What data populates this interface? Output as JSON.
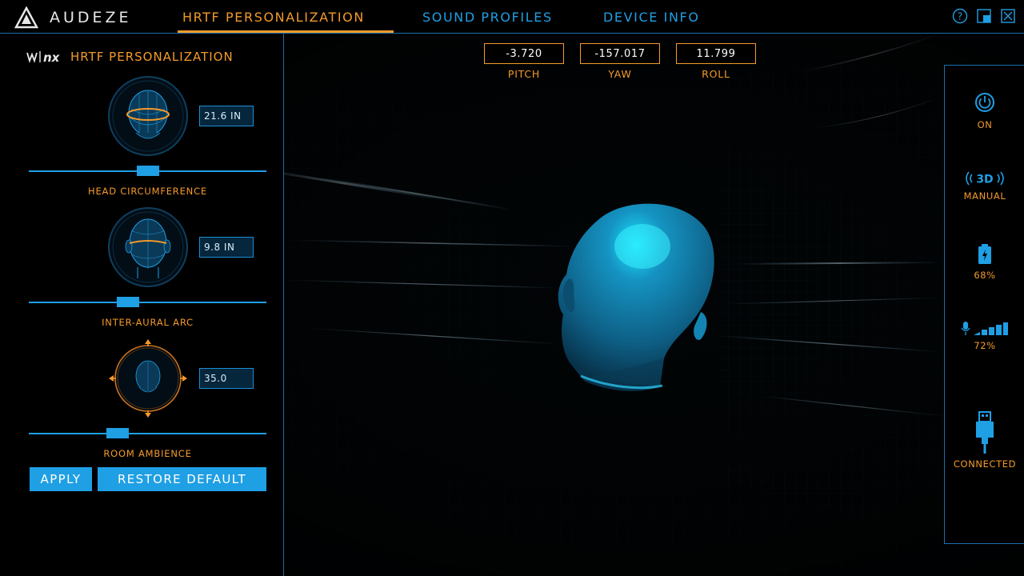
{
  "app": {
    "brand": "AUDEZE",
    "nav_tabs": [
      {
        "label": "HRTF PERSONALIZATION",
        "active": true
      },
      {
        "label": "SOUND PROFILES",
        "active": false
      },
      {
        "label": "DEVICE INFO",
        "active": false
      }
    ]
  },
  "hrtf": {
    "title": "HRTF PERSONALIZATION",
    "logo_mark": "nx",
    "params": [
      {
        "label": "HEAD CIRCUMFERENCE",
        "value": "21.6 IN",
        "slider_pct": 50
      },
      {
        "label": "INTER-AURAL ARC",
        "value": "9.8 IN",
        "slider_pct": 41
      },
      {
        "label": "ROOM AMBIENCE",
        "value": "35.0",
        "slider_pct": 36
      }
    ],
    "apply_label": "APPLY",
    "restore_label": "RESTORE DEFAULT"
  },
  "orientation": {
    "pitch": {
      "value": "-3.720",
      "label": "PITCH"
    },
    "yaw": {
      "value": "-157.017",
      "label": "YAW"
    },
    "roll": {
      "value": "11.799",
      "label": "ROLL"
    }
  },
  "status": {
    "power": {
      "label": "ON",
      "icon": "power-icon"
    },
    "mode": {
      "badge": "3D",
      "label": "MANUAL",
      "icon": "3d-audio-icon"
    },
    "battery": {
      "label": "68%",
      "level": 0.68,
      "icon": "battery-icon"
    },
    "signal": {
      "label": "72%",
      "level": 0.72,
      "icon": "mic-signal-icon"
    },
    "connection": {
      "label": "CONNECTED",
      "icon": "usb-icon"
    }
  },
  "colors": {
    "accent_orange": "#f39a2b",
    "accent_blue": "#1f9fe4",
    "head_cyan": "#1ea6d6"
  }
}
